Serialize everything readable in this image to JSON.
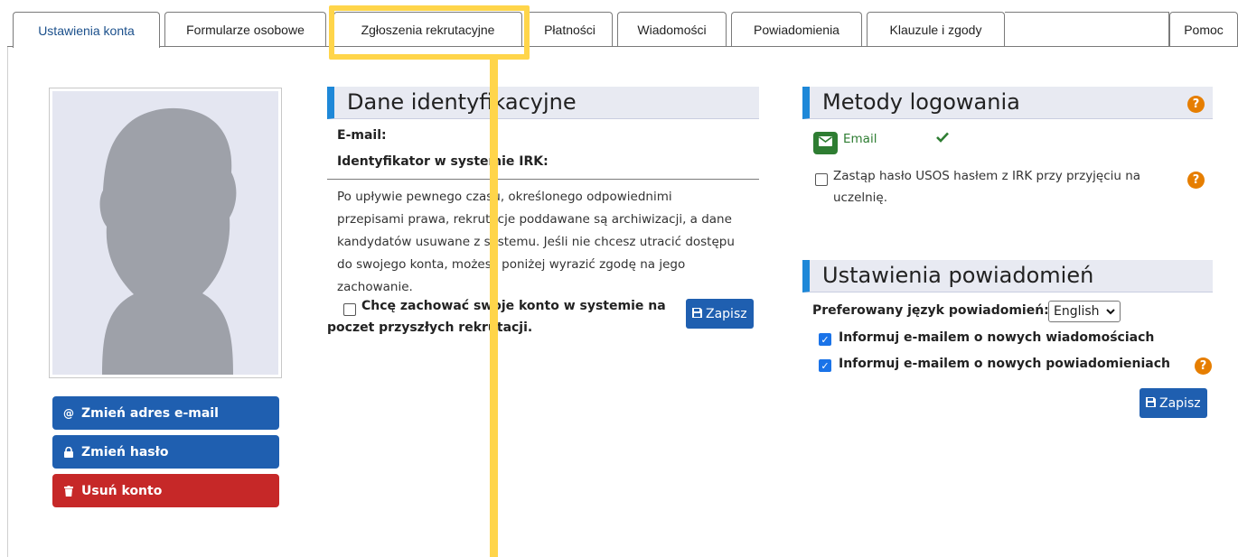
{
  "tabs": [
    {
      "label": "Ustawienia konta"
    },
    {
      "label": "Formularze osobowe"
    },
    {
      "label": "Zgłoszenia rekrutacyjne"
    },
    {
      "label": "Płatności"
    },
    {
      "label": "Wiadomości"
    },
    {
      "label": "Powiadomienia"
    },
    {
      "label": "Klauzule i zgody"
    },
    {
      "label": "Pomoc"
    }
  ],
  "left_buttons": {
    "change_email": "Zmień adres e-mail",
    "change_password": "Zmień hasło",
    "delete_account": "Usuń konto"
  },
  "identity": {
    "title": "Dane identyfikacyjne",
    "email_label": "E-mail:",
    "irk_label": "Identyfikator w systemie IRK:",
    "info_lines": [
      "Po upływie pewnego czasu, określonego odpowiednimi",
      "przepisami prawa, rekrutacje poddawane są archiwizacji, a dane",
      "kandydatów usuwane z systemu. Jeśli nie chcesz utracić dostępu",
      "do swojego konta, możesz poniżej wyrazić zgodę na jego",
      "zachowanie."
    ],
    "keep_account_line1": "Chcę zachować swoje konto w systemie na",
    "keep_account_line2": "poczet przyszłych rekrutacji.",
    "save_label": "Zapisz"
  },
  "login_methods": {
    "title": "Metody logowania",
    "email_method": "Email",
    "replace_password_line1": "Zastąp hasło USOS hasłem z IRK przy przyjęciu na",
    "replace_password_line2": "uczelnię."
  },
  "notification_settings": {
    "title": "Ustawienia powiadomień",
    "language_label": "Preferowany język powiadomień:",
    "language_value": "English",
    "notify_messages": "Informuj e-mailem o nowych wiadomościach",
    "notify_notifications": "Informuj e-mailem o nowych powiadomieniach",
    "save_label": "Zapisz"
  },
  "colors": {
    "accent_blue": "#1f5fb0",
    "danger_red": "#c62828",
    "help_orange": "#e67e00",
    "success_green": "#2e7d32",
    "highlight_yellow": "#ffd54a"
  }
}
